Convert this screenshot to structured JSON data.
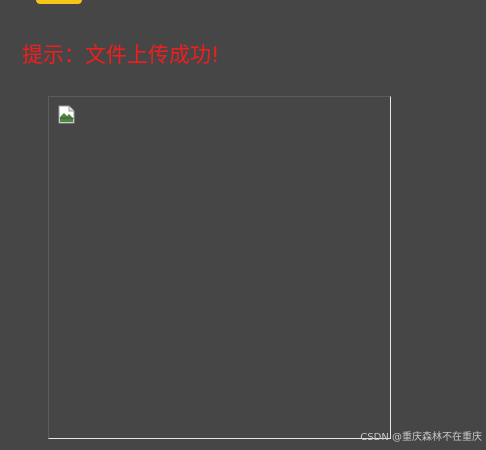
{
  "message": {
    "text": "提示：文件上传成功!",
    "color": "#f21e1e"
  },
  "top_button": {
    "color": "#f5c518"
  },
  "preview": {
    "icon": "broken-image-icon"
  },
  "watermark": {
    "text": "CSDN @重庆森林不在重庆"
  },
  "colors": {
    "background": "#464646"
  }
}
